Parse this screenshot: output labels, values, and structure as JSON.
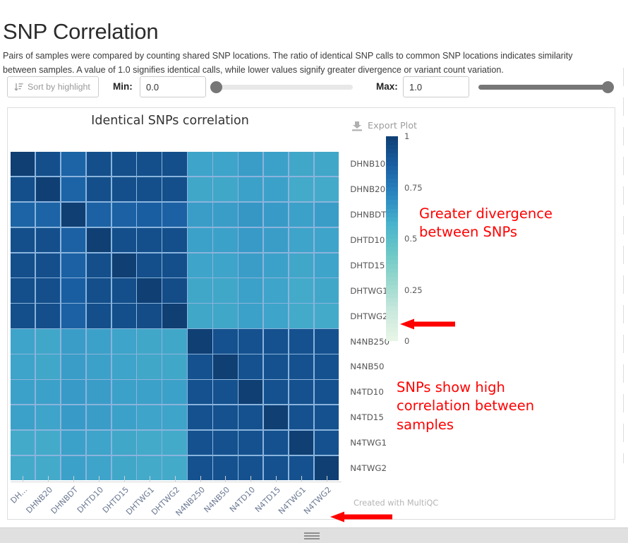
{
  "header": {
    "title": "SNP Correlation",
    "description": "Pairs of samples were compared by counting shared SNP locations. The ratio of identical SNP calls to common SNP locations indicates similarity between samples. A value of 1.0 signifies identical calls, while lower values signify greater divergence or variant count variation."
  },
  "controls": {
    "sort_button_label": "Sort by highlight",
    "sort_icon": "sort-descending-icon",
    "min_label": "Min:",
    "min_value": "0.0",
    "min_slider_position_pct": 0,
    "max_label": "Max:",
    "max_value": "1.0",
    "max_slider_position_pct": 100
  },
  "plot": {
    "title": "Identical SNPs correlation",
    "export_label": "Export Plot",
    "export_icon": "download-icon",
    "credit": "Created with MultiQC"
  },
  "annotations": [
    {
      "id": "divergence",
      "text": "Greater divergence\nbetween SNPs",
      "color": "#ff0000",
      "arrow": "left-arrow-icon"
    },
    {
      "id": "correlation",
      "text": "SNPs show high\ncorrelation between\nsamples",
      "color": "#ff0000",
      "arrow": "left-arrow-icon"
    }
  ],
  "colorbar": {
    "ticks": [
      "1",
      "0.75",
      "0.5",
      "0.25",
      "0"
    ],
    "tick_values": [
      1,
      0.75,
      0.5,
      0.25,
      0
    ],
    "min": 0,
    "max": 1,
    "stops": [
      "#e8f6e6",
      "#c9e8dd",
      "#9ad9cd",
      "#6cc8c6",
      "#49b3cd",
      "#2a86c0",
      "#1a5fa3",
      "#0f3f73"
    ]
  },
  "chart_data": {
    "type": "heatmap",
    "title": "Identical SNPs correlation",
    "xlabel": "",
    "ylabel": "",
    "zmin": 0,
    "zmax": 1,
    "legend_position": "right",
    "grid": true,
    "x_labels": [
      "DH...",
      "DHNB20",
      "DHNBDT",
      "DHTD10",
      "DHTD15",
      "DHTWG1",
      "DHTWG2",
      "N4NB250",
      "N4NB50",
      "N4TD10",
      "N4TD15",
      "N4TWG1",
      "N4TWG2"
    ],
    "x_labels_full": [
      "DHNB10",
      "DHNB20",
      "DHNBDT",
      "DHTD10",
      "DHTD15",
      "DHTWG1",
      "DHTWG2",
      "N4NB250",
      "N4NB50",
      "N4TD10",
      "N4TD15",
      "N4TWG1",
      "N4TWG2"
    ],
    "y_labels": [
      "DHNB10",
      "DHNB20",
      "DHNBDT",
      "DHTD10",
      "DHTD15",
      "DHTWG1",
      "DHTWG2",
      "N4NB250",
      "N4NB50",
      "N4TD10",
      "N4TD15",
      "N4TWG1",
      "N4TWG2"
    ],
    "values": [
      [
        1.0,
        0.93,
        0.84,
        0.93,
        0.93,
        0.93,
        0.93,
        0.62,
        0.62,
        0.64,
        0.63,
        0.61,
        0.61
      ],
      [
        0.93,
        1.0,
        0.84,
        0.93,
        0.93,
        0.93,
        0.93,
        0.61,
        0.61,
        0.63,
        0.63,
        0.6,
        0.6
      ],
      [
        0.84,
        0.84,
        1.0,
        0.85,
        0.85,
        0.86,
        0.85,
        0.64,
        0.64,
        0.66,
        0.65,
        0.63,
        0.64
      ],
      [
        0.93,
        0.93,
        0.85,
        1.0,
        0.93,
        0.93,
        0.93,
        0.63,
        0.63,
        0.65,
        0.64,
        0.62,
        0.62
      ],
      [
        0.93,
        0.93,
        0.85,
        0.93,
        1.0,
        0.93,
        0.93,
        0.62,
        0.62,
        0.64,
        0.63,
        0.61,
        0.62
      ],
      [
        0.93,
        0.93,
        0.86,
        0.93,
        0.93,
        1.0,
        0.94,
        0.61,
        0.61,
        0.63,
        0.62,
        0.6,
        0.61
      ],
      [
        0.93,
        0.93,
        0.85,
        0.93,
        0.93,
        0.94,
        1.0,
        0.61,
        0.61,
        0.63,
        0.62,
        0.6,
        0.6
      ],
      [
        0.62,
        0.61,
        0.64,
        0.63,
        0.62,
        0.61,
        0.61,
        1.0,
        0.92,
        0.92,
        0.92,
        0.92,
        0.92
      ],
      [
        0.62,
        0.61,
        0.64,
        0.63,
        0.62,
        0.61,
        0.61,
        0.92,
        1.0,
        0.92,
        0.92,
        0.92,
        0.92
      ],
      [
        0.63,
        0.63,
        0.65,
        0.64,
        0.63,
        0.63,
        0.63,
        0.92,
        0.92,
        1.0,
        0.92,
        0.92,
        0.92
      ],
      [
        0.63,
        0.62,
        0.65,
        0.64,
        0.63,
        0.62,
        0.62,
        0.92,
        0.92,
        0.92,
        1.0,
        0.92,
        0.92
      ],
      [
        0.6,
        0.6,
        0.63,
        0.62,
        0.61,
        0.6,
        0.6,
        0.92,
        0.92,
        0.92,
        0.92,
        1.0,
        0.92
      ],
      [
        0.6,
        0.6,
        0.63,
        0.62,
        0.61,
        0.6,
        0.6,
        0.92,
        0.92,
        0.92,
        0.92,
        0.92,
        1.0
      ]
    ]
  }
}
